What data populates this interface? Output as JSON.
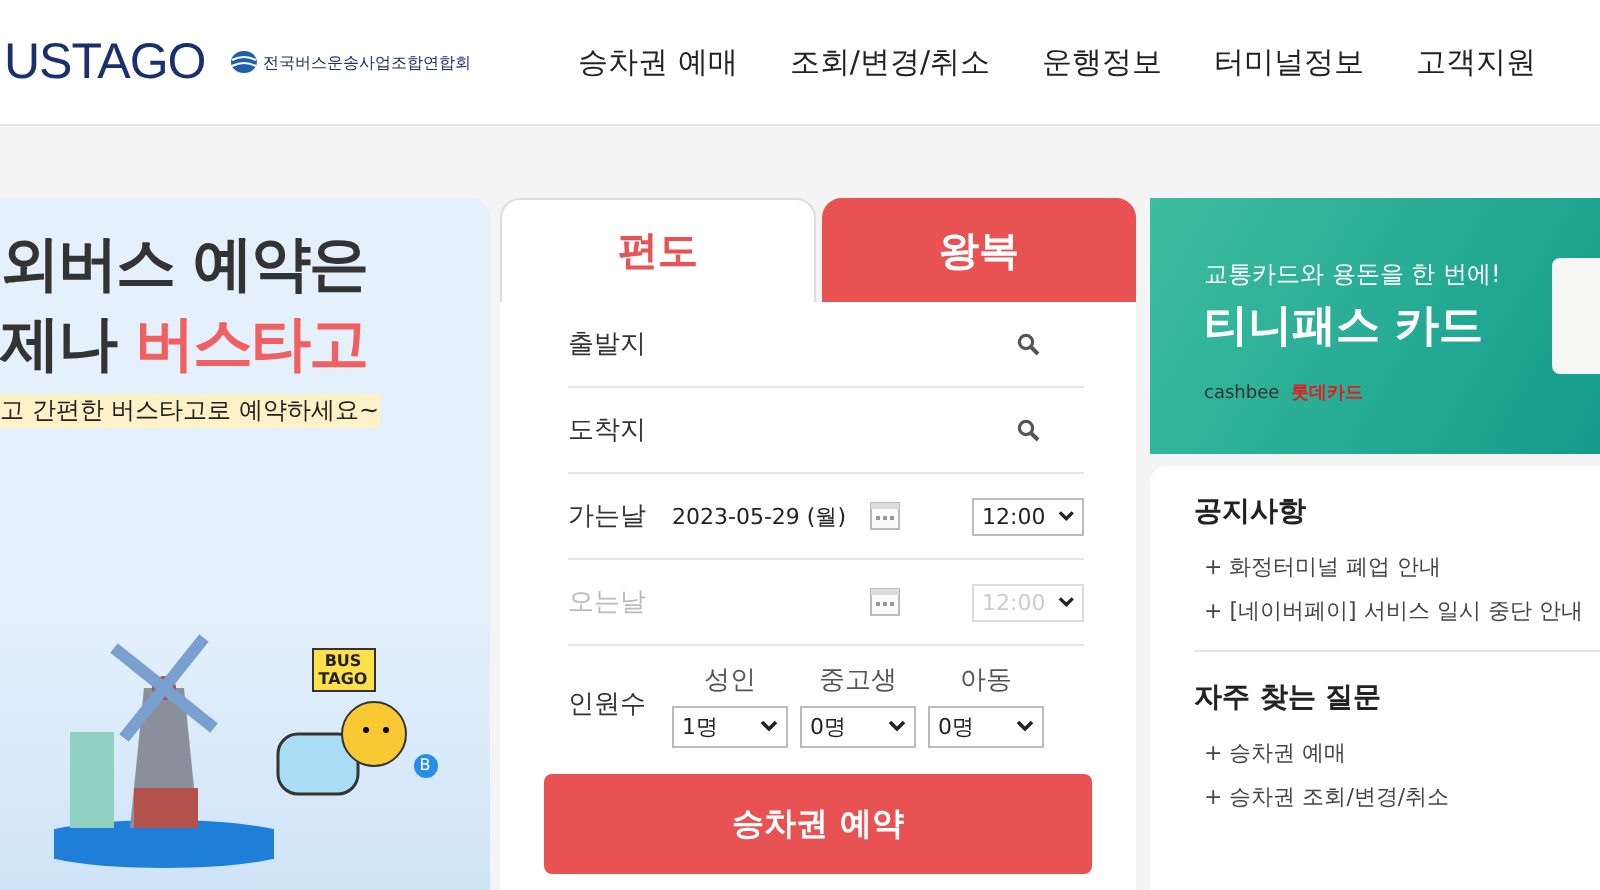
{
  "header": {
    "logo": "USTAGO",
    "org": "전국버스운송사업조합연합회",
    "nav": [
      "승차권 예매",
      "조회/변경/취소",
      "운행정보",
      "터미널정보",
      "고객지원"
    ]
  },
  "banner": {
    "line1": "외버스 예약은",
    "line2": "제나",
    "line2_highlight": "버스타고",
    "tagline": "고 간편한 버스타고로 예약하세요~",
    "sign": "BUS TAGO",
    "stop": "B"
  },
  "booking": {
    "tabs": [
      {
        "label": "편도",
        "selected": true
      },
      {
        "label": "왕복",
        "selected": false
      }
    ],
    "fields": [
      {
        "kind": "place",
        "label": "출발지",
        "disabled": false
      },
      {
        "kind": "place",
        "label": "도착지",
        "disabled": false
      },
      {
        "kind": "date",
        "label": "가는날",
        "value": "2023-05-29 (월)",
        "time": "12:00",
        "disabled": false
      },
      {
        "kind": "date",
        "label": "오는날",
        "time": "12:00",
        "disabled": true
      }
    ],
    "passengers": {
      "label": "인원수",
      "groups": [
        {
          "label": "성인",
          "value": "1명"
        },
        {
          "label": "중고생",
          "value": "0명"
        },
        {
          "label": "아동",
          "value": "0명"
        }
      ]
    },
    "submit": "승차권 예약"
  },
  "promo": {
    "subtitle": "교통카드와 용돈을 한 번에!",
    "title": "티니패스 카드",
    "brand1": "cashbee",
    "brand2": "롯데카드"
  },
  "notices": {
    "title": "공지사항",
    "items": [
      "+ 화정터미널 폐업 안내",
      "+ [네이버페이] 서비스 일시 중단 안내"
    ]
  },
  "faq": {
    "title": "자주 찾는 질문",
    "items": [
      "+ 승차권 예매",
      "+ 승차권 조회/변경/취소"
    ]
  }
}
